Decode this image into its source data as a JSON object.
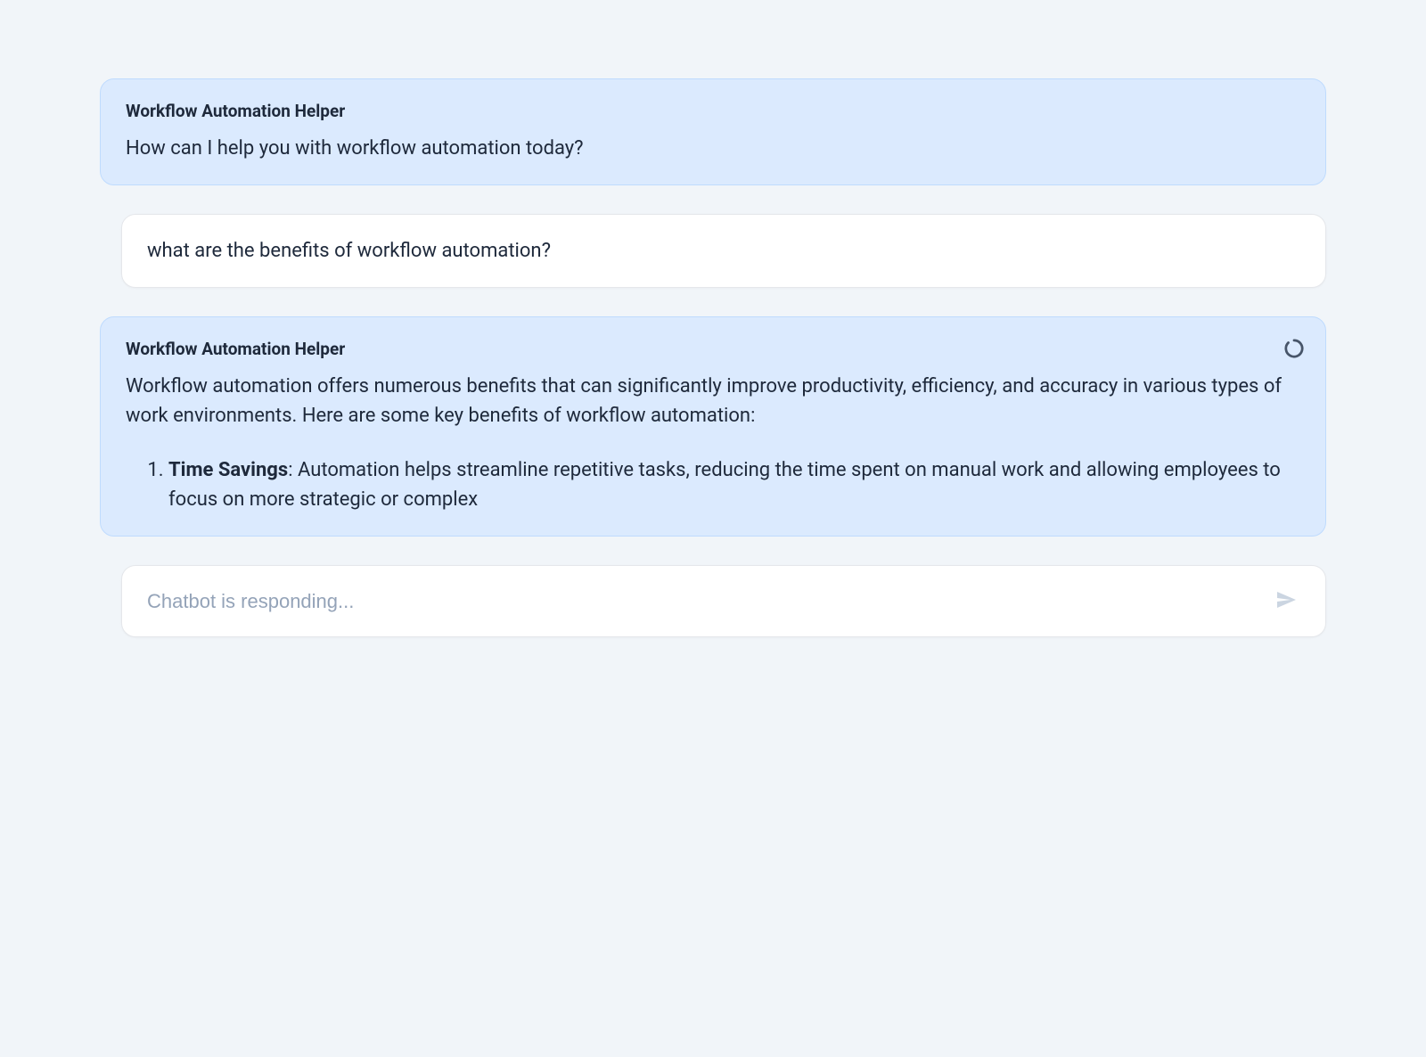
{
  "bot_name": "Workflow Automation Helper",
  "messages": {
    "greeting": "How can I help you with workflow automation today?",
    "user_question": "what are the benefits of workflow automation?",
    "response_intro": "Workflow automation offers numerous benefits that can significantly improve productivity, efficiency, and accuracy in various types of work environments. Here are some key benefits of workflow automation:",
    "response_items": [
      {
        "title": "Time Savings",
        "text": ": Automation helps streamline repetitive tasks, reducing the time spent on manual work and allowing employees to focus on more strategic or complex"
      }
    ]
  },
  "input": {
    "placeholder": "Chatbot is responding..."
  }
}
